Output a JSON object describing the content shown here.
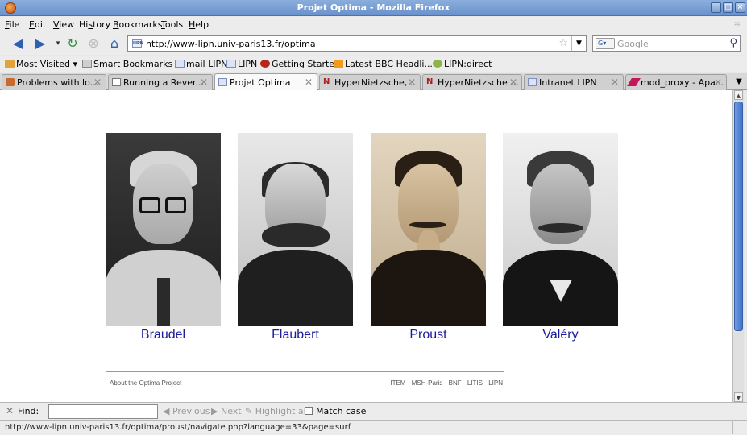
{
  "window": {
    "title": "Projet Optima - Mozilla Firefox"
  },
  "menu": [
    {
      "prefix": "",
      "key": "F",
      "rest": "ile"
    },
    {
      "prefix": "",
      "key": "E",
      "rest": "dit"
    },
    {
      "prefix": "",
      "key": "V",
      "rest": "iew"
    },
    {
      "prefix": "Hi",
      "key": "s",
      "rest": "tory"
    },
    {
      "prefix": "",
      "key": "B",
      "rest": "ookmarks"
    },
    {
      "prefix": "",
      "key": "T",
      "rest": "ools"
    },
    {
      "prefix": "",
      "key": "H",
      "rest": "elp"
    }
  ],
  "navigation": {
    "url": "http://www-lipn.univ-paris13.fr/optima",
    "search_placeholder": "Google",
    "favicon_text": "LIPN"
  },
  "bookmarks": [
    "Most Visited ▾",
    "Smart Bookmarks ▾",
    "mail LIPN",
    "LIPN",
    "Getting Started",
    "Latest BBC Headli... ▾",
    "LIPN:direct"
  ],
  "tabs": [
    {
      "label": "Problems with lo...",
      "active": false
    },
    {
      "label": "Running a Rever...",
      "active": false
    },
    {
      "label": "Projet Optima",
      "active": true
    },
    {
      "label": "HyperNietzsche, ...",
      "active": false
    },
    {
      "label": "HyperNietzsche ...",
      "active": false
    },
    {
      "label": "Intranet LIPN",
      "active": false
    },
    {
      "label": "mod_proxy - Apa...",
      "active": false
    }
  ],
  "authors": [
    "Braudel",
    "Flaubert",
    "Proust",
    "Valéry"
  ],
  "footer": {
    "about": "About the Optima Project",
    "links": [
      "ITEM",
      "MSH-Paris",
      "BNF",
      "LITIS",
      "LIPN"
    ]
  },
  "findbar": {
    "label": "Find:",
    "previous": "Previous",
    "next": "Next",
    "highlight": "Highlight all",
    "match_case": "Match case"
  },
  "status": {
    "text": "http://www-lipn.univ-paris13.fr/optima/proust/navigate.php?language=33&page=surf"
  }
}
